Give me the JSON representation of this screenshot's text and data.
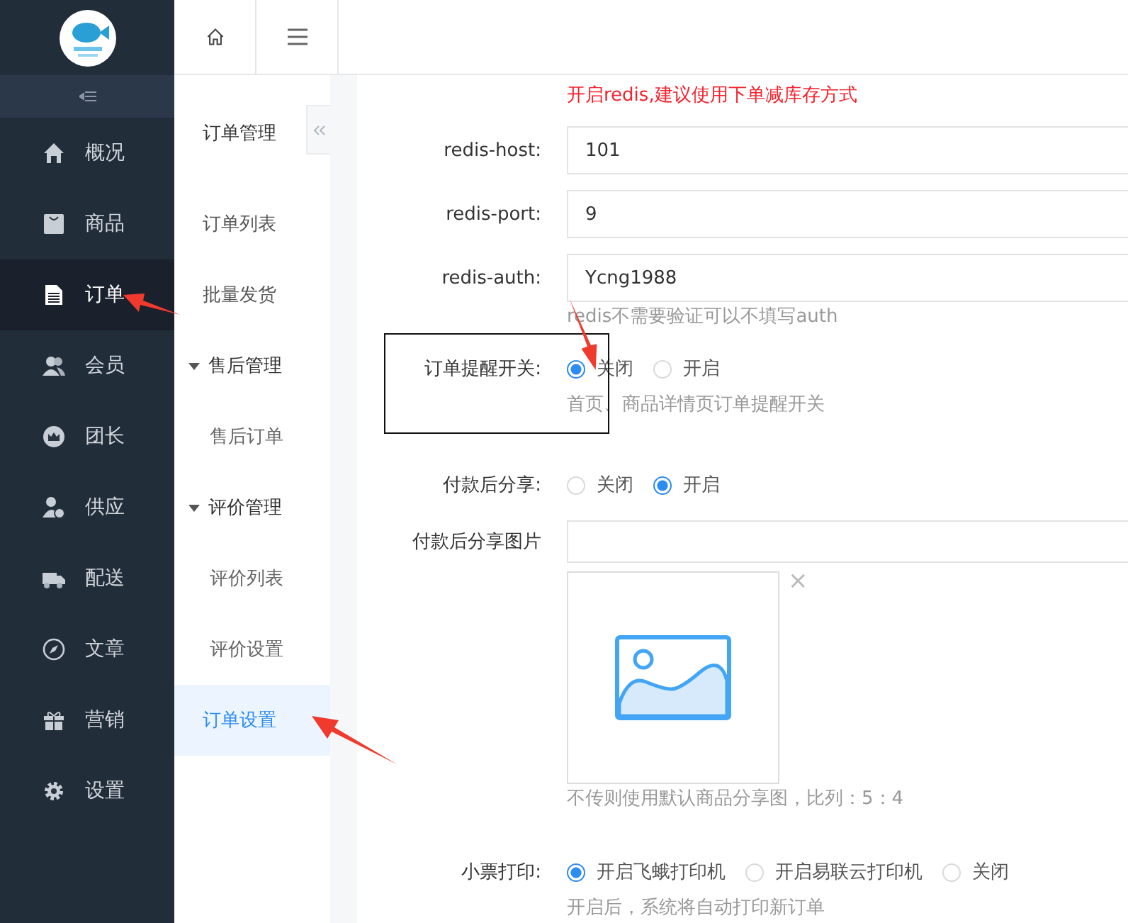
{
  "sidebar": {
    "items": [
      {
        "label": "概况",
        "selected": false
      },
      {
        "label": "商品",
        "selected": false
      },
      {
        "label": "订单",
        "selected": true
      },
      {
        "label": "会员",
        "selected": false
      },
      {
        "label": "团长",
        "selected": false
      },
      {
        "label": "供应",
        "selected": false
      },
      {
        "label": "配送",
        "selected": false
      },
      {
        "label": "文章",
        "selected": false
      },
      {
        "label": "营销",
        "selected": false
      },
      {
        "label": "设置",
        "selected": false
      }
    ]
  },
  "submenu": {
    "title": "订单管理",
    "items": [
      {
        "label": "订单列表",
        "kind": "item",
        "selected": false
      },
      {
        "label": "批量发货",
        "kind": "item",
        "selected": false
      },
      {
        "label": "售后管理",
        "kind": "group",
        "selected": false
      },
      {
        "label": "售后订单",
        "kind": "child",
        "selected": false
      },
      {
        "label": "评价管理",
        "kind": "group",
        "selected": false
      },
      {
        "label": "评价列表",
        "kind": "child",
        "selected": false
      },
      {
        "label": "评价设置",
        "kind": "child",
        "selected": false
      },
      {
        "label": "订单设置",
        "kind": "item",
        "selected": true
      }
    ]
  },
  "form": {
    "notice": "开启redis,建议使用下单减库存方式",
    "fields": [
      {
        "label": "redis-host:",
        "value": "101"
      },
      {
        "label": "redis-port:",
        "value": "9"
      },
      {
        "label": "redis-auth:",
        "value": "Ycng1988"
      }
    ],
    "fields_hint": "redis不需要验证可以不填写auth",
    "order_reminder": {
      "label": "订单提醒开关:",
      "options": [
        {
          "label": "关闭",
          "selected": true
        },
        {
          "label": "开启",
          "selected": false
        }
      ],
      "hint": "首页、商品详情页订单提醒开关"
    },
    "share_after_pay": {
      "label": "付款后分享:",
      "options": [
        {
          "label": "关闭",
          "selected": false
        },
        {
          "label": "开启",
          "selected": true
        }
      ]
    },
    "share_image": {
      "label": "付款后分享图片",
      "remove": "×",
      "hint": "不传则使用默认商品分享图，比列：5：4"
    },
    "receipt_print": {
      "label": "小票打印:",
      "options": [
        {
          "label": "开启飞蛾打印机",
          "selected": true
        },
        {
          "label": "开启易联云打印机",
          "selected": false
        },
        {
          "label": "关闭",
          "selected": false
        }
      ],
      "hint": "开启后，系统将自动打印新订单"
    }
  }
}
